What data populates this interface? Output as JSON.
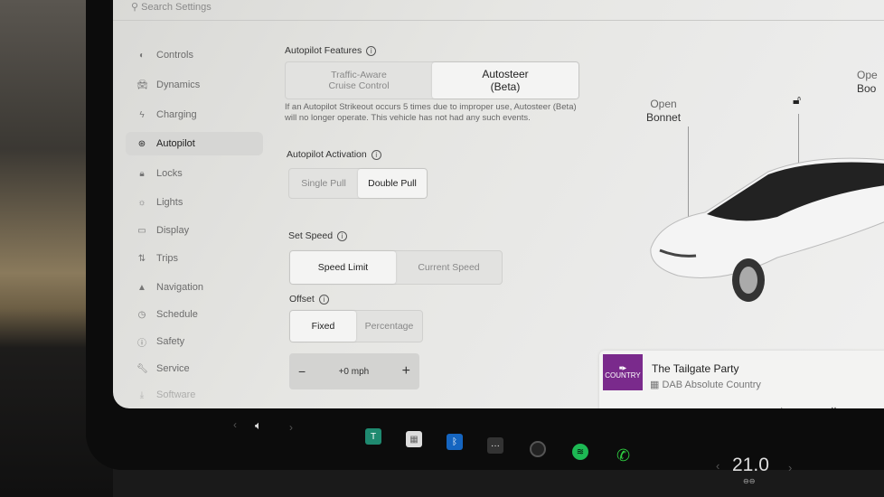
{
  "search": {
    "placeholder": "Search Settings"
  },
  "sidebar": {
    "items": [
      {
        "label": "Controls",
        "icon": "toggle-icon"
      },
      {
        "label": "Dynamics",
        "icon": "car-icon"
      },
      {
        "label": "Charging",
        "icon": "bolt-icon"
      },
      {
        "label": "Autopilot",
        "icon": "steering-wheel-icon",
        "active": true
      },
      {
        "label": "Locks",
        "icon": "lock-icon"
      },
      {
        "label": "Lights",
        "icon": "sun-icon"
      },
      {
        "label": "Display",
        "icon": "display-icon"
      },
      {
        "label": "Trips",
        "icon": "trips-icon"
      },
      {
        "label": "Navigation",
        "icon": "navigation-icon"
      },
      {
        "label": "Schedule",
        "icon": "clock-icon"
      },
      {
        "label": "Safety",
        "icon": "safety-icon"
      },
      {
        "label": "Service",
        "icon": "wrench-icon"
      },
      {
        "label": "Software",
        "icon": "download-icon"
      }
    ]
  },
  "autopilot": {
    "features_title": "Autopilot Features",
    "features": [
      {
        "line1": "Traffic-Aware",
        "line2": "Cruise Control",
        "selected": false
      },
      {
        "line1": "Autosteer",
        "line2": "(Beta)",
        "selected": true
      }
    ],
    "strikeout_note": "If an Autopilot Strikeout occurs 5 times due to improper use, Autosteer (Beta) will no longer operate. This vehicle has not had any such events.",
    "activation_title": "Autopilot Activation",
    "activation": [
      {
        "label": "Single Pull",
        "selected": false
      },
      {
        "label": "Double Pull",
        "selected": true
      }
    ],
    "set_speed_title": "Set Speed",
    "set_speed": [
      {
        "label": "Speed Limit",
        "selected": true
      },
      {
        "label": "Current Speed",
        "selected": false
      }
    ],
    "offset_title": "Offset",
    "offset": [
      {
        "label": "Fixed",
        "selected": true
      },
      {
        "label": "Percentage",
        "selected": false
      }
    ],
    "offset_value": "+0 mph",
    "minus": "−",
    "plus": "+"
  },
  "car": {
    "open_bonnet_line1": "Open",
    "open_bonnet_line2": "Bonnet",
    "open_boot_line1": "Ope",
    "open_boot_line2": "Boo"
  },
  "media": {
    "art_label": "COUNTRY",
    "title": "The Tailgate Party",
    "source": "DAB Absolute Country",
    "accent": "#7a2a8c"
  },
  "taskbar": {
    "temperature": "21.0"
  }
}
